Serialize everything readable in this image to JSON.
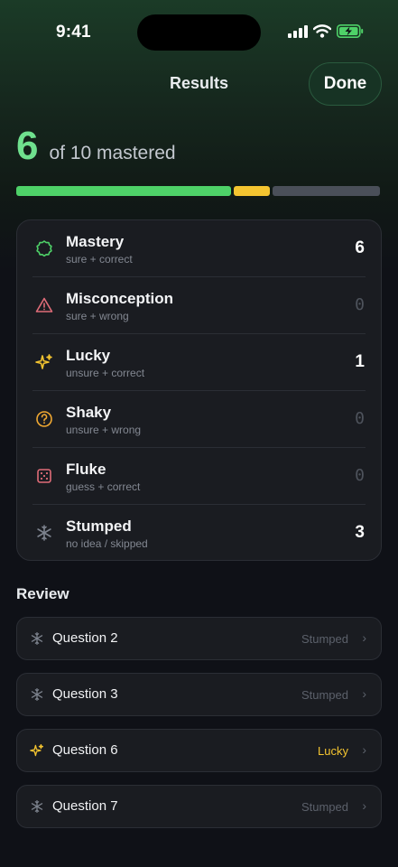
{
  "status_bar": {
    "time": "9:41"
  },
  "nav": {
    "title": "Results",
    "done_label": "Done"
  },
  "score": {
    "mastered": "6",
    "suffix": "of 10 mastered",
    "total": 10
  },
  "progress": {
    "segments": [
      {
        "name": "mastered",
        "count": 6,
        "color": "#4ed168"
      },
      {
        "name": "lucky",
        "count": 1,
        "color": "#f4c430"
      },
      {
        "name": "remaining",
        "count": 3,
        "color": "#4a4f59"
      }
    ]
  },
  "categories": [
    {
      "key": "mastery",
      "icon": "mastery-badge-icon",
      "title": "Mastery",
      "subtitle": "sure + correct",
      "count": "6",
      "zero": false,
      "color": "#4ed168"
    },
    {
      "key": "misconception",
      "icon": "warning-triangle-icon",
      "title": "Misconception",
      "subtitle": "sure + wrong",
      "count": "0",
      "zero": true,
      "color": "#e06c78"
    },
    {
      "key": "lucky",
      "icon": "sparkles-icon",
      "title": "Lucky",
      "subtitle": "unsure + correct",
      "count": "1",
      "zero": false,
      "color": "#f4c430"
    },
    {
      "key": "shaky",
      "icon": "question-circle-icon",
      "title": "Shaky",
      "subtitle": "unsure + wrong",
      "count": "0",
      "zero": true,
      "color": "#f0a832"
    },
    {
      "key": "fluke",
      "icon": "dice-icon",
      "title": "Fluke",
      "subtitle": "guess + correct",
      "count": "0",
      "zero": true,
      "color": "#e06c78"
    },
    {
      "key": "stumped",
      "icon": "snowflake-icon",
      "title": "Stumped",
      "subtitle": "no idea / skipped",
      "count": "3",
      "zero": false,
      "color": "#7d838e"
    }
  ],
  "review": {
    "heading": "Review",
    "items": [
      {
        "title": "Question 2",
        "tag": "Stumped",
        "icon": "snowflake-icon"
      },
      {
        "title": "Question 3",
        "tag": "Stumped",
        "icon": "snowflake-icon"
      },
      {
        "title": "Question 6",
        "tag": "Lucky",
        "icon": "sparkles-icon"
      },
      {
        "title": "Question 7",
        "tag": "Stumped",
        "icon": "snowflake-icon"
      }
    ]
  }
}
